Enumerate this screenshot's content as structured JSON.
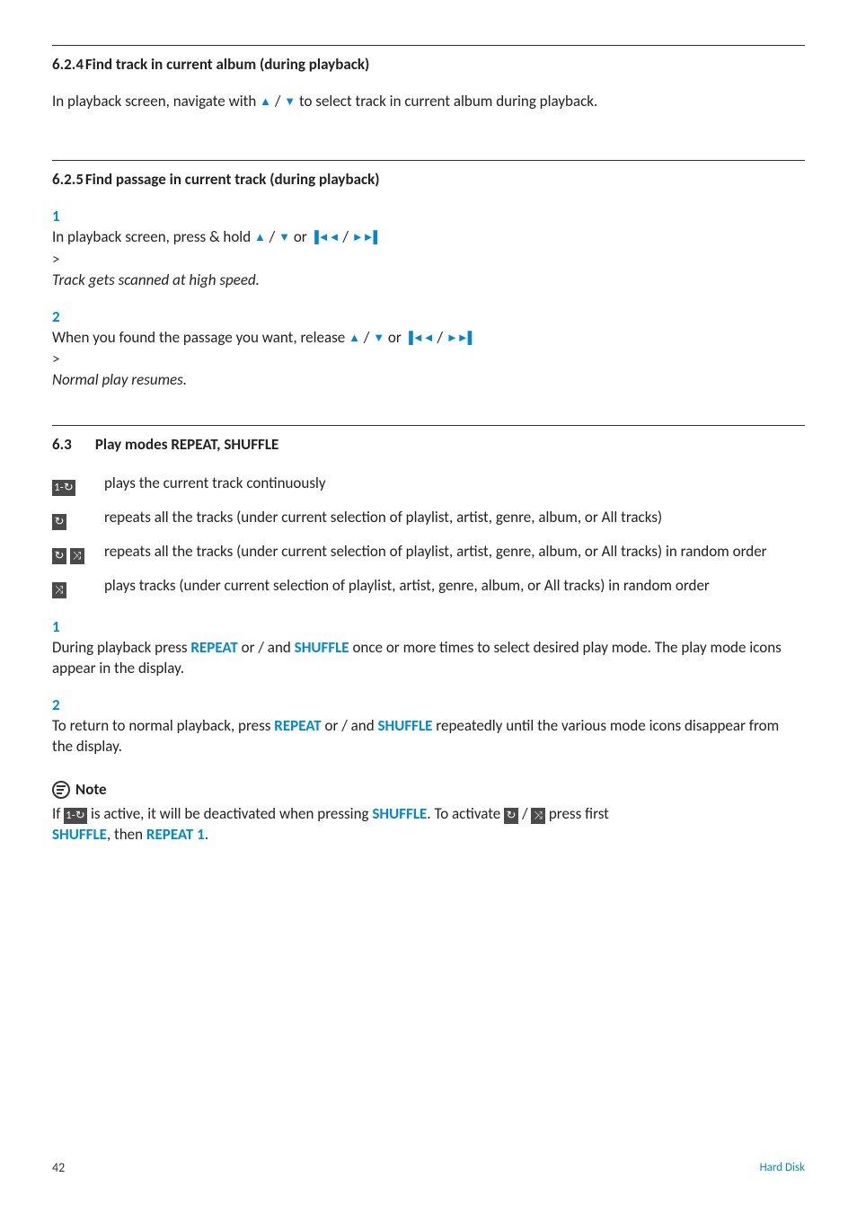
{
  "sections": {
    "s624": {
      "number": "6.2.4",
      "title": "Find track in current album (during playback)",
      "text_pre": "In playback screen, navigate with ",
      "text_post": " to select track in current album during playback."
    },
    "s625": {
      "number": "6.2.5",
      "title": "Find passage in current track (during playback)",
      "steps": [
        {
          "n": "1",
          "text_pre": "In playback screen, press & hold ",
          "result": "Track gets scanned at high speed."
        },
        {
          "n": "2",
          "text_pre": "When you found the passage you want, release ",
          "result": "Normal play resumes."
        }
      ]
    },
    "s63": {
      "number": "6.3",
      "title": "Play modes REPEAT, SHUFFLE",
      "modes": [
        {
          "icon": "repeat1",
          "text": "plays the current track continuously"
        },
        {
          "icon": "repeat",
          "text": "repeats all the tracks (under current selection of playlist, artist, genre, album, or All tracks)"
        },
        {
          "icon": "repeat_shuffle",
          "text": "repeats all the tracks (under current selection of playlist, artist, genre, album, or All tracks) in random order"
        },
        {
          "icon": "shuffle",
          "text": "plays tracks (under current selection of playlist, artist, genre, album, or All tracks) in random order"
        }
      ],
      "actions": [
        {
          "n": "1",
          "pre": "During playback press ",
          "mid": " or / and ",
          "post": " once or more times to select desired play mode. The play mode icons appear in the display."
        },
        {
          "n": "2",
          "pre": "To return to normal playback, press ",
          "mid": " or / and ",
          "post": " repeatedly until the various mode icons disappear from the display."
        }
      ],
      "note": {
        "label": "Note",
        "line_pre": "If ",
        "line_mid1": " is active, it will be deactivated when pressing ",
        "line_mid2": ". To activate ",
        "line_mid3": " / ",
        "line_mid4": " press first ",
        "line_post": ", then ",
        "line_end": "."
      }
    }
  },
  "buttons": {
    "repeat": "REPEAT",
    "shuffle": "SHUFFLE",
    "repeat1": "REPEAT 1"
  },
  "glyphs": {
    "up": "▲",
    "down": "▼",
    "sep": " / ",
    "or": " or ",
    "prev": "▐◄◄",
    "next": "►►▌"
  },
  "icon_labels": {
    "repeat1": "1-↻",
    "repeat": "↻",
    "shuffle": "⤨"
  },
  "footer": {
    "page": "42",
    "label": "Hard Disk"
  }
}
